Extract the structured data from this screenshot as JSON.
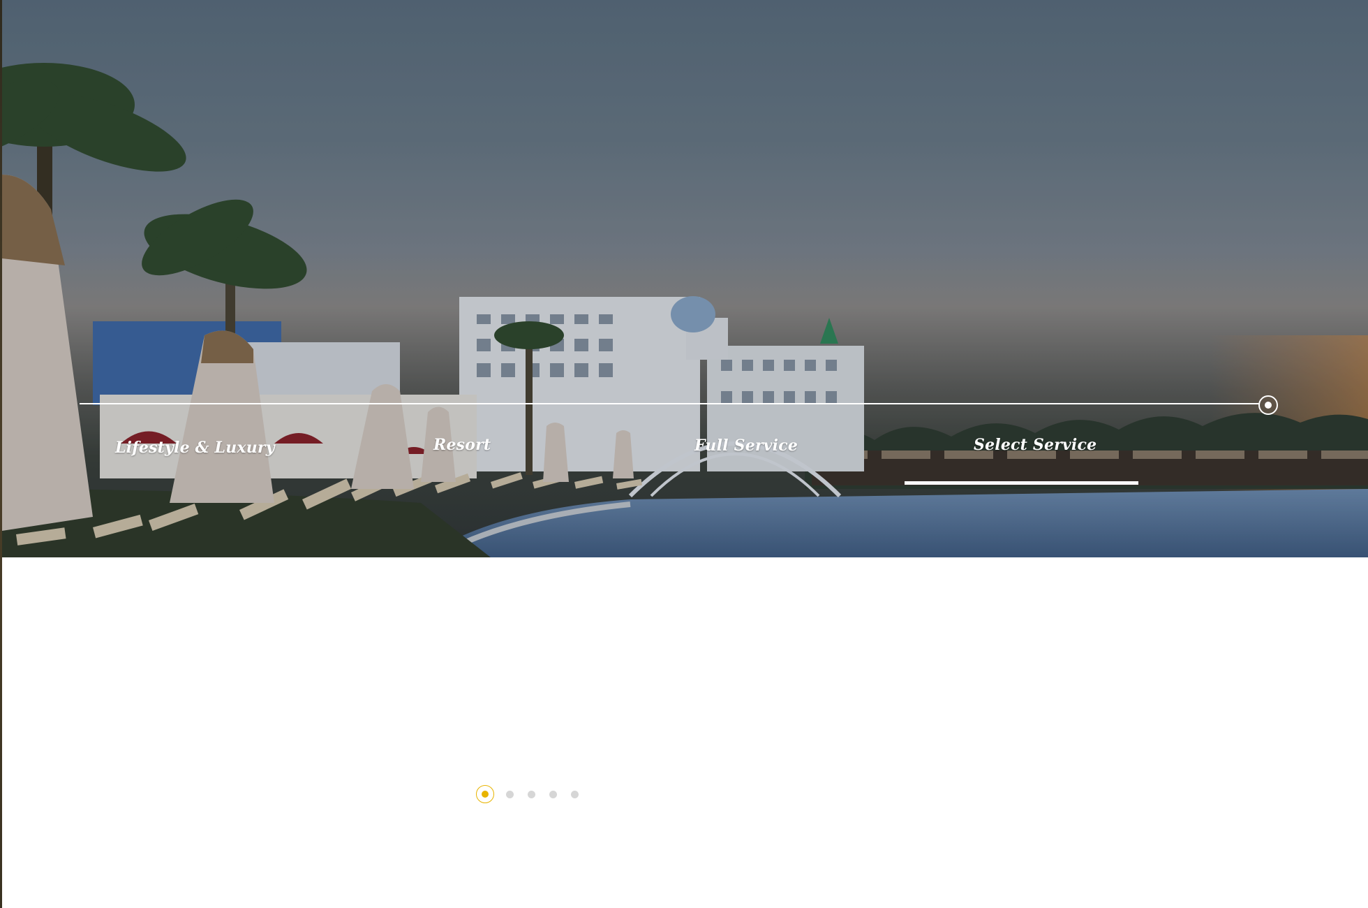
{
  "hero": {
    "image_alt": "Resort pool with palm trees and white hotel buildings at dusk"
  },
  "tabs": [
    {
      "label": "Lifestyle & Luxury",
      "active": false
    },
    {
      "label": "Resort",
      "active": false
    },
    {
      "label": "Full Service",
      "active": false
    },
    {
      "label": "Select Service",
      "active": true
    }
  ],
  "pagination": {
    "count": 5,
    "active_index": 0,
    "accent_color": "#e8b400"
  },
  "colors": {
    "tab_text": "#ffffff",
    "dot_inactive": "#d6d6d6"
  }
}
